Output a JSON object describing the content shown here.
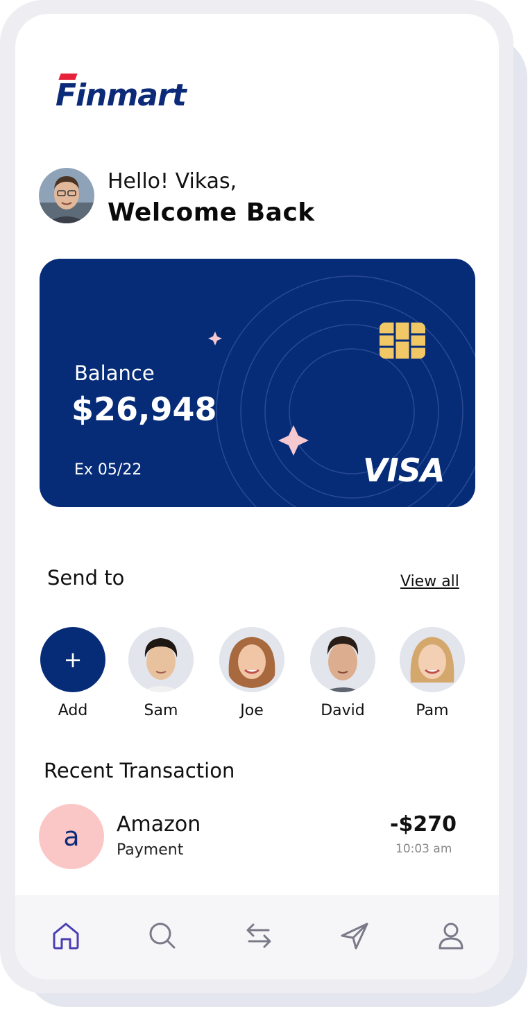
{
  "brand": {
    "name": "Finmart"
  },
  "greeting": {
    "hello": "Hello! Vikas,",
    "welcome": "Welcome Back"
  },
  "card": {
    "balance_label": "Balance",
    "balance_value": "$26,948",
    "expiry": "Ex 05/22",
    "network": "VISA",
    "color": "#062c78"
  },
  "send_to": {
    "title": "Send to",
    "view_all": "View all",
    "contacts": [
      {
        "name": "Add",
        "icon": "plus-icon"
      },
      {
        "name": "Sam"
      },
      {
        "name": "Joe"
      },
      {
        "name": "David"
      },
      {
        "name": "Pam"
      }
    ]
  },
  "recent": {
    "title": "Recent Transaction",
    "items": [
      {
        "initial": "a",
        "name": "Amazon",
        "type": "Payment",
        "amount": "-$270",
        "time": "10:03 am"
      }
    ]
  },
  "nav": {
    "items": [
      {
        "icon": "home-icon",
        "active": true
      },
      {
        "icon": "search-icon"
      },
      {
        "icon": "transfer-icon"
      },
      {
        "icon": "send-icon"
      },
      {
        "icon": "profile-icon"
      }
    ],
    "active_color": "#4a3fb0",
    "inactive_color": "#7a7a88"
  }
}
